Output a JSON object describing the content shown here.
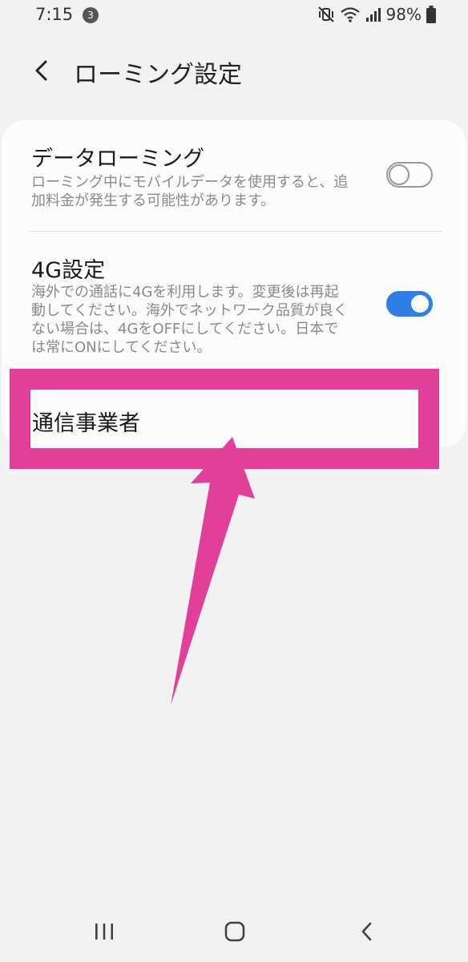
{
  "status_bar": {
    "time": "7:15",
    "notification_count": "3",
    "battery": "98%"
  },
  "header": {
    "title": "ローミング設定"
  },
  "settings": {
    "data_roaming": {
      "title": "データローミング",
      "description": "ローミング中にモバイルデータを使用すると、追加料金が発生する可能性があります。",
      "enabled": false
    },
    "lte": {
      "title": "4G設定",
      "description": "海外での通話に4Gを利用します。変更後は再起動してください。海外でネットワーク品質が良くない場合は、4GをOFFにしてください。日本では常にONにしてください。",
      "enabled": true
    },
    "carrier": {
      "label": "通信事業者"
    }
  },
  "colors": {
    "accent": "#2f7fe6",
    "highlight": "#e23f9a",
    "background": "#f2f2f2",
    "card": "#fcfcfc"
  },
  "icons": {
    "back": "chevron-left-icon",
    "mute": "vibrate-mute-icon",
    "wifi": "wifi-icon",
    "signal": "signal-icon",
    "battery": "battery-icon",
    "nav_recent": "recent-apps-icon",
    "nav_home": "home-icon",
    "nav_back": "nav-back-icon"
  }
}
